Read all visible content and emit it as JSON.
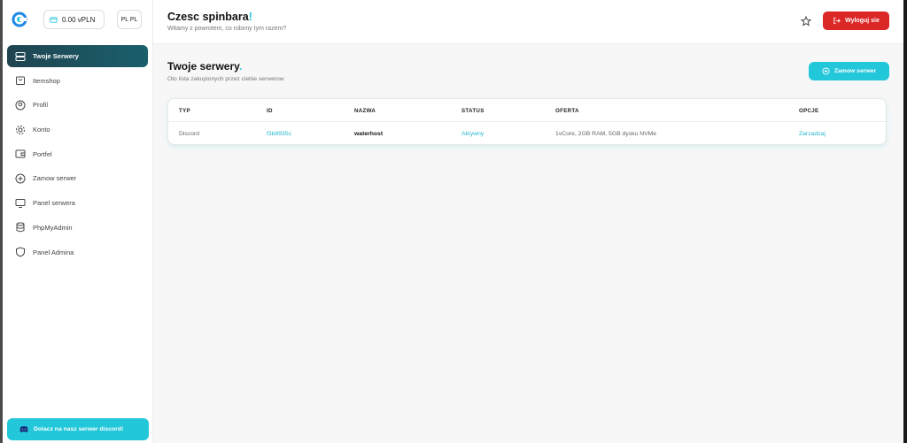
{
  "sidebar": {
    "wallet": "0.00 vPLN",
    "lang": "PL PL",
    "items": [
      {
        "label": "Twoje Serwery",
        "icon": "server-icon",
        "active": true
      },
      {
        "label": "Itemshop",
        "icon": "shopping-bag-icon"
      },
      {
        "label": "Profil",
        "icon": "user-icon"
      },
      {
        "label": "Konto",
        "icon": "gear-icon"
      },
      {
        "label": "Portfel",
        "icon": "wallet-icon"
      },
      {
        "label": "Zamow serwer",
        "icon": "plus-circle-icon"
      },
      {
        "label": "Panel serwera",
        "icon": "monitor-icon"
      },
      {
        "label": "PhpMyAdmin",
        "icon": "database-icon"
      },
      {
        "label": "Panel Admina",
        "icon": "shield-icon"
      }
    ],
    "discord_label": "Dolacz na nasz serwer discord!"
  },
  "header": {
    "title": "Czesc spinbara",
    "title_dot": "!",
    "subtitle": "Witamy z powrotem, co robimy tym razem?",
    "logout_label": "Wyloguj sie"
  },
  "servers": {
    "title": "Twoje serwery",
    "title_dot": ".",
    "subtitle": "Oto lista zakupionych przez ciebie serwerow",
    "order_label": "Zamow serwer",
    "columns": [
      "TYP",
      "ID",
      "NAZWA",
      "STATUS",
      "OFERTA",
      "OPCJE"
    ],
    "rows": [
      {
        "typ": "Discord",
        "id": "f3b8935c",
        "nazwa": "waterhost",
        "status": "Aktywny",
        "oferta": "1vCore, 2GB RAM, 5GB dysku NVMe",
        "opcje": "Zarzadzaj"
      }
    ]
  },
  "colors": {
    "accent": "#22c7da",
    "danger": "#dc2727",
    "active_nav": "#1f4450"
  }
}
